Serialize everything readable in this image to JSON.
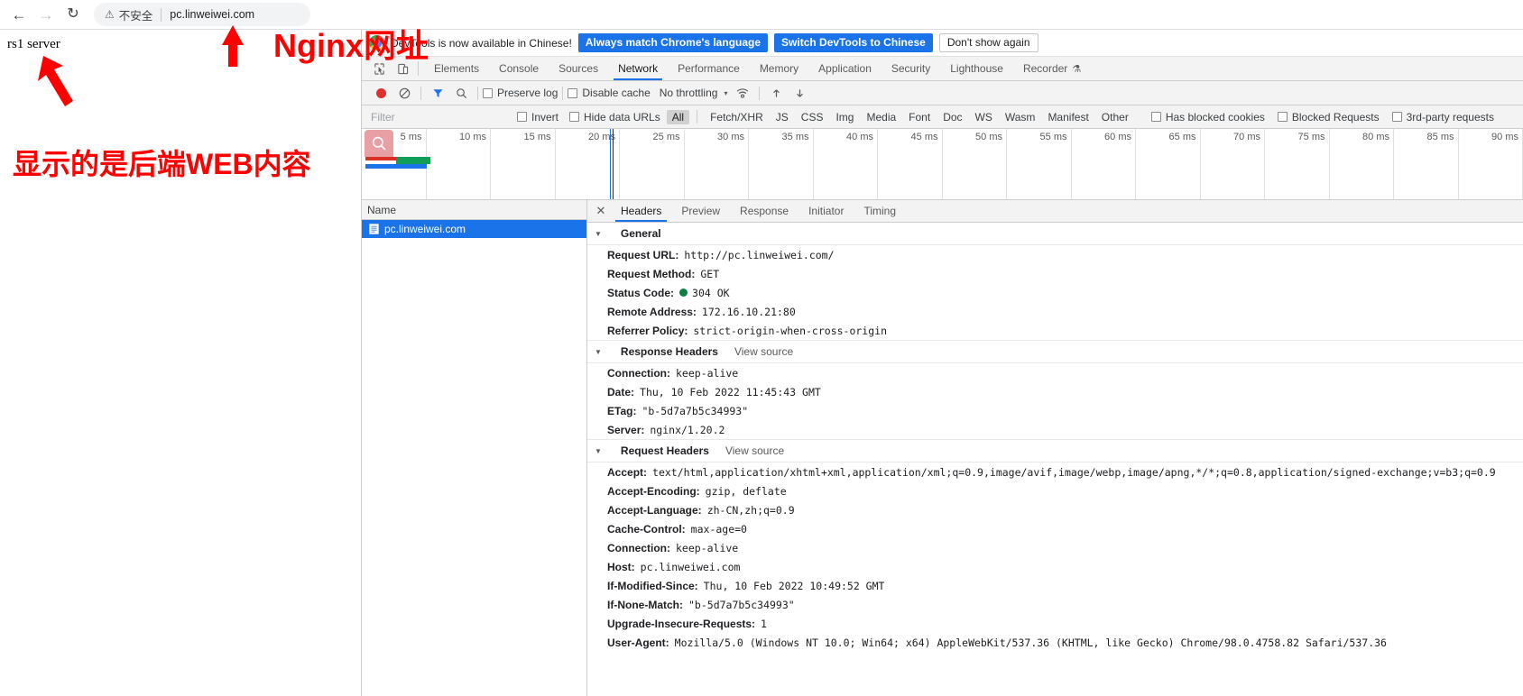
{
  "browser": {
    "back_icon": "back-arrow-icon",
    "forward_icon": "forward-arrow-icon",
    "reload_icon": "reload-icon",
    "security_icon": "not-secure-warning-icon",
    "security_label": "不安全",
    "url": "pc.linweiwei.com"
  },
  "page": {
    "body_text": "rs1 server"
  },
  "annotations": {
    "nginx_label": "Nginx网址",
    "backend_label": "显示的是后端WEB内容",
    "color": "#ff0000"
  },
  "devtools": {
    "notification": {
      "text": "DevTools is now available in Chinese!",
      "primary_button": "Always match Chrome's language",
      "secondary_button": "Switch DevTools to Chinese",
      "dismiss_button": "Don't show again",
      "accent_color": "#1a73e8"
    },
    "tools": {
      "inspect_icon": "inspect-element-icon",
      "device_icon": "toggle-device-toolbar-icon",
      "tabs": [
        {
          "label": "Elements",
          "active": false
        },
        {
          "label": "Console",
          "active": false
        },
        {
          "label": "Sources",
          "active": false
        },
        {
          "label": "Network",
          "active": true
        },
        {
          "label": "Performance",
          "active": false
        },
        {
          "label": "Memory",
          "active": false
        },
        {
          "label": "Application",
          "active": false
        },
        {
          "label": "Security",
          "active": false
        },
        {
          "label": "Lighthouse",
          "active": false
        },
        {
          "label": "Recorder",
          "active": false
        }
      ],
      "recorder_badge": "⚗"
    },
    "network_toolbar": {
      "record_icon": "record-button-icon",
      "clear_icon": "clear-network-log-icon",
      "filter_icon": "filter-funnel-icon",
      "search_icon": "search-icon",
      "preserve_log_label": "Preserve log",
      "preserve_log_checked": false,
      "disable_cache_label": "Disable cache",
      "disable_cache_checked": false,
      "throttling_value": "No throttling",
      "throttling_caret": "▾",
      "wifi_icon": "network-conditions-icon",
      "import_icon": "import-har-icon",
      "export_icon": "export-har-icon"
    },
    "filter_bar": {
      "filter_placeholder": "Filter",
      "filter_value": "",
      "invert_label": "Invert",
      "invert_checked": false,
      "hide_data_urls_label": "Hide data URLs",
      "hide_data_urls_checked": false,
      "types": [
        "All",
        "Fetch/XHR",
        "JS",
        "CSS",
        "Img",
        "Media",
        "Font",
        "Doc",
        "WS",
        "Wasm",
        "Manifest",
        "Other"
      ],
      "active_type": "All",
      "has_blocked_cookies_label": "Has blocked cookies",
      "blocked_requests_label": "Blocked Requests",
      "third_party_label": "3rd-party requests"
    },
    "overview": {
      "zoom_icon": "overview-search-icon",
      "ticks": [
        "5 ms",
        "10 ms",
        "15 ms",
        "20 ms",
        "25 ms",
        "30 ms",
        "35 ms",
        "40 ms",
        "45 ms",
        "50 ms",
        "55 ms",
        "60 ms",
        "65 ms",
        "70 ms",
        "75 ms",
        "80 ms",
        "85 ms",
        "90 ms"
      ]
    },
    "request_list": {
      "column_header": "Name",
      "rows": [
        {
          "name": "pc.linweiwei.com",
          "selected": true,
          "icon": "document-icon"
        }
      ]
    },
    "detail_tabs": {
      "close_icon": "close-icon",
      "tabs": [
        {
          "label": "Headers",
          "active": true
        },
        {
          "label": "Preview",
          "active": false
        },
        {
          "label": "Response",
          "active": false
        },
        {
          "label": "Initiator",
          "active": false
        },
        {
          "label": "Timing",
          "active": false
        }
      ]
    },
    "sections": [
      {
        "title": "General",
        "view_source": "",
        "rows": [
          {
            "name": "Request URL:",
            "value": "http://pc.linweiwei.com/"
          },
          {
            "name": "Request Method:",
            "value": "GET"
          },
          {
            "name": "Status Code:",
            "value": "304 OK",
            "status_dot": "#0c8043"
          },
          {
            "name": "Remote Address:",
            "value": "172.16.10.21:80"
          },
          {
            "name": "Referrer Policy:",
            "value": "strict-origin-when-cross-origin"
          }
        ]
      },
      {
        "title": "Response Headers",
        "view_source": "View source",
        "rows": [
          {
            "name": "Connection:",
            "value": "keep-alive"
          },
          {
            "name": "Date:",
            "value": "Thu, 10 Feb 2022 11:45:43 GMT"
          },
          {
            "name": "ETag:",
            "value": "\"b-5d7a7b5c34993\""
          },
          {
            "name": "Server:",
            "value": "nginx/1.20.2"
          }
        ]
      },
      {
        "title": "Request Headers",
        "view_source": "View source",
        "rows": [
          {
            "name": "Accept:",
            "value": "text/html,application/xhtml+xml,application/xml;q=0.9,image/avif,image/webp,image/apng,*/*;q=0.8,application/signed-exchange;v=b3;q=0.9"
          },
          {
            "name": "Accept-Encoding:",
            "value": "gzip, deflate"
          },
          {
            "name": "Accept-Language:",
            "value": "zh-CN,zh;q=0.9"
          },
          {
            "name": "Cache-Control:",
            "value": "max-age=0"
          },
          {
            "name": "Connection:",
            "value": "keep-alive"
          },
          {
            "name": "Host:",
            "value": "pc.linweiwei.com"
          },
          {
            "name": "If-Modified-Since:",
            "value": "Thu, 10 Feb 2022 10:49:52 GMT"
          },
          {
            "name": "If-None-Match:",
            "value": "\"b-5d7a7b5c34993\""
          },
          {
            "name": "Upgrade-Insecure-Requests:",
            "value": "1"
          },
          {
            "name": "User-Agent:",
            "value": "Mozilla/5.0 (Windows NT 10.0; Win64; x64) AppleWebKit/537.36 (KHTML, like Gecko) Chrome/98.0.4758.82 Safari/537.36"
          }
        ]
      }
    ]
  }
}
